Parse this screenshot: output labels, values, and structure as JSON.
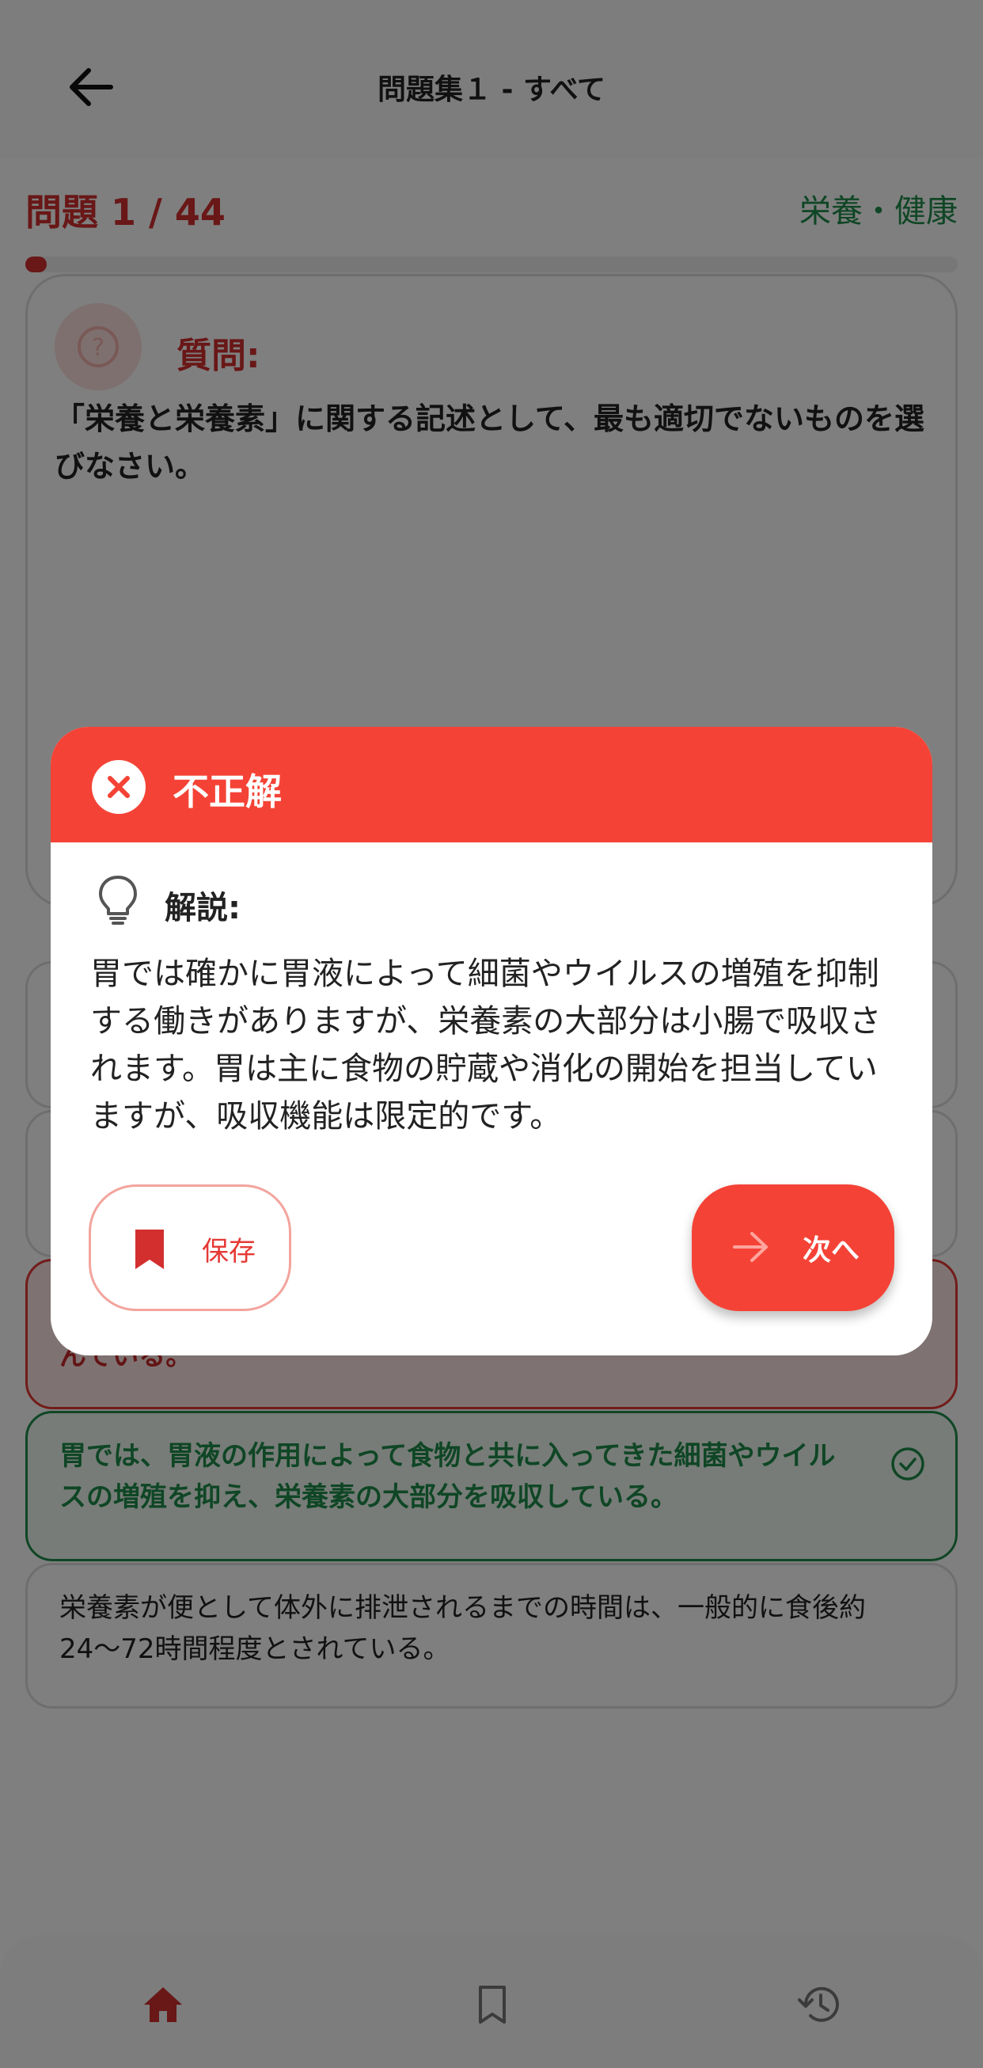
{
  "header": {
    "title": "問題集１ - すべて"
  },
  "quiz": {
    "counter": "問題 1 / 44",
    "category": "栄養・健康",
    "progress": 0.023,
    "question_label": "質問:",
    "question_text": "「栄養と栄養素」に関する記述として、最も適切でないものを選びなさい。"
  },
  "options": [
    {
      "text": "",
      "state": "normal"
    },
    {
      "text": "",
      "state": "normal"
    },
    {
      "text": "んでいる。",
      "state": "wrong"
    },
    {
      "text": "胃では、胃液の作用によって食物と共に入ってきた細菌やウイルスの増殖を抑え、栄養素の大部分を吸収している。",
      "state": "correct"
    },
    {
      "text": "栄養素が便として体外に排泄されるまでの時間は、一般的に食後約24〜72時間程度とされている。",
      "state": "normal"
    }
  ],
  "modal": {
    "title": "不正解",
    "explanation_label": "解説:",
    "explanation": "胃では確かに胃液によって細菌やウイルスの増殖を抑制する働きがありますが、栄養素の大部分は小腸で吸収されます。胃は主に食物の貯蔵や消化の開始を担当していますが、吸収機能は限定的です。",
    "save_label": "保存",
    "next_label": "次へ"
  },
  "nav": {
    "items": [
      {
        "icon": "home-icon",
        "active": true
      },
      {
        "icon": "bookmark-icon",
        "active": false
      },
      {
        "icon": "history-icon",
        "active": false
      }
    ]
  },
  "colors": {
    "accent_red": "#f44336",
    "question_red": "#d32f2f",
    "category_green": "#1e8c4a",
    "overlay": "rgba(0,0,0,0.5)"
  }
}
